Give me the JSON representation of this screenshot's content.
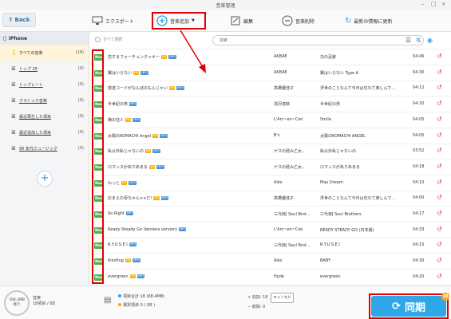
{
  "window": {
    "title": "音楽管理",
    "controls": [
      "‒",
      "□",
      "×"
    ]
  },
  "toolbar": {
    "back_label": "Back",
    "export_label": "エクスポート",
    "add_label": "音楽追加",
    "edit_label": "編集",
    "delete_label": "音楽削除",
    "refresh_label": "最新の情報に更新"
  },
  "sidebar": {
    "device": "iPhone",
    "items": [
      {
        "label": "すべての音楽",
        "count": "(18)",
        "icon": "music-note-icon"
      },
      {
        "label": "トップ 25",
        "count": "(0)",
        "icon": "playlist-icon"
      },
      {
        "label": "トップレート",
        "count": "(0)",
        "icon": "playlist-icon"
      },
      {
        "label": "クラシック音楽",
        "count": "(0)",
        "icon": "playlist-icon"
      },
      {
        "label": "最近再生した項目",
        "count": "(0)",
        "icon": "playlist-icon"
      },
      {
        "label": "最近追加した項目",
        "count": "(0)",
        "icon": "playlist-icon"
      },
      {
        "label": "90 年代ミュージック",
        "count": "(0)",
        "icon": "playlist-icon"
      }
    ],
    "add_symbol": "+"
  },
  "list": {
    "select_all_label": "すべて選択",
    "search_placeholder": "検索",
    "new_badge": "New",
    "rows": [
      {
        "name": "恋するフォーチュンクッキー",
        "tags": [
          "HD",
          "MP3"
        ],
        "artist": "AKB48",
        "album": "次の足跡",
        "time": "04:46"
      },
      {
        "name": "翼はいらない",
        "tags": [
          "HD",
          "MP3"
        ],
        "artist": "AKB48",
        "album": "翼はいらない Type A",
        "time": "04:30"
      },
      {
        "name": "放送コードがなんぼのもんじゃい",
        "tags": [
          "HD",
          "MP3"
        ],
        "artist": "高橋優佳子",
        "album": "浮世のことなんて今日は忘れて楽しんで…",
        "time": "04:12"
      },
      {
        "name": "半世紀の男",
        "tags": [
          "MP3"
        ],
        "artist": "渕沢達郎",
        "album": "半世紀の男",
        "time": "04:20"
      },
      {
        "name": "陣の住人",
        "tags": [
          "HD",
          "MP3"
        ],
        "artist": "L'Arc~en~Ciel",
        "album": "Smile",
        "time": "04:05"
      },
      {
        "name": "太陽のKOMACHI Angel",
        "tags": [
          "HD",
          "MP3"
        ],
        "artist": "B'z",
        "album": "太陽のKOMACHI ANGEL",
        "time": "04:05"
      },
      {
        "name": "私以外私じゃないの",
        "tags": [
          "HD",
          "MP3"
        ],
        "artist": "ゲスの極み乙女。",
        "album": "私以外私じゃないの",
        "time": "03:52"
      },
      {
        "name": "ロマンスがありあまる",
        "tags": [
          "HD",
          "MP3"
        ],
        "artist": "ゲスの極み乙女。",
        "album": "ロマンスがありあまる",
        "time": "04:18"
      },
      {
        "name": "わっと",
        "tags": [
          "HD",
          "MP3"
        ],
        "artist": "Aiko",
        "album": "May Dream",
        "time": "04:10"
      },
      {
        "name": "おまえの母ちゃん××だ!",
        "tags": [
          "HD",
          "MP3"
        ],
        "artist": "高橋優佳子",
        "album": "浮世のことなんて今日は忘れて楽しんで…",
        "time": "04:00"
      },
      {
        "name": "So Right",
        "tags": [
          "MP3"
        ],
        "artist": "三代目J Soul Brot…",
        "album": "三代目J Soul Brothers",
        "time": "04:17"
      },
      {
        "name": "Ready Steady Go (kenless version)",
        "tags": [
          "MP3"
        ],
        "artist": "L'Arc~en~Ciel",
        "album": "READY STEADY GO (日本版)",
        "time": "04:33"
      },
      {
        "name": "R.Y.U.S.E.I",
        "tags": [
          "MP3"
        ],
        "artist": "三代目J Soul Brot…",
        "album": "R.Y.U.S.E.I",
        "time": "04:15"
      },
      {
        "name": "KissHug",
        "tags": [
          "HD",
          "MP3"
        ],
        "artist": "Aiko",
        "album": "BABY",
        "time": "04:30"
      },
      {
        "name": "evergreen",
        "tags": [
          "HD",
          "MP3"
        ],
        "artist": "Hyde",
        "album": "evergreen",
        "time": "04:20"
      }
    ]
  },
  "footer": {
    "storage_size": "708.3MB",
    "storage_free_label": "残り",
    "storage_type": "音楽",
    "storage_count": "18項目 / 0B",
    "total_label": "項目合計 18 (68.4MB)",
    "selected_label": "選択項目 0 ( 0B )",
    "added_label": "追加: 18",
    "cancel_label": "キャンセル",
    "deleted_label": "削除: 0",
    "sync_label": "同期",
    "sync_badge": "18",
    "colors": {
      "total_dot": "#2ea6e8",
      "selected_dot": "#f5a623"
    }
  },
  "colors": {
    "accent": "#2ea6e8",
    "highlight": "#e00000",
    "new_badge": "#4caf50",
    "undo": "#e53935"
  }
}
